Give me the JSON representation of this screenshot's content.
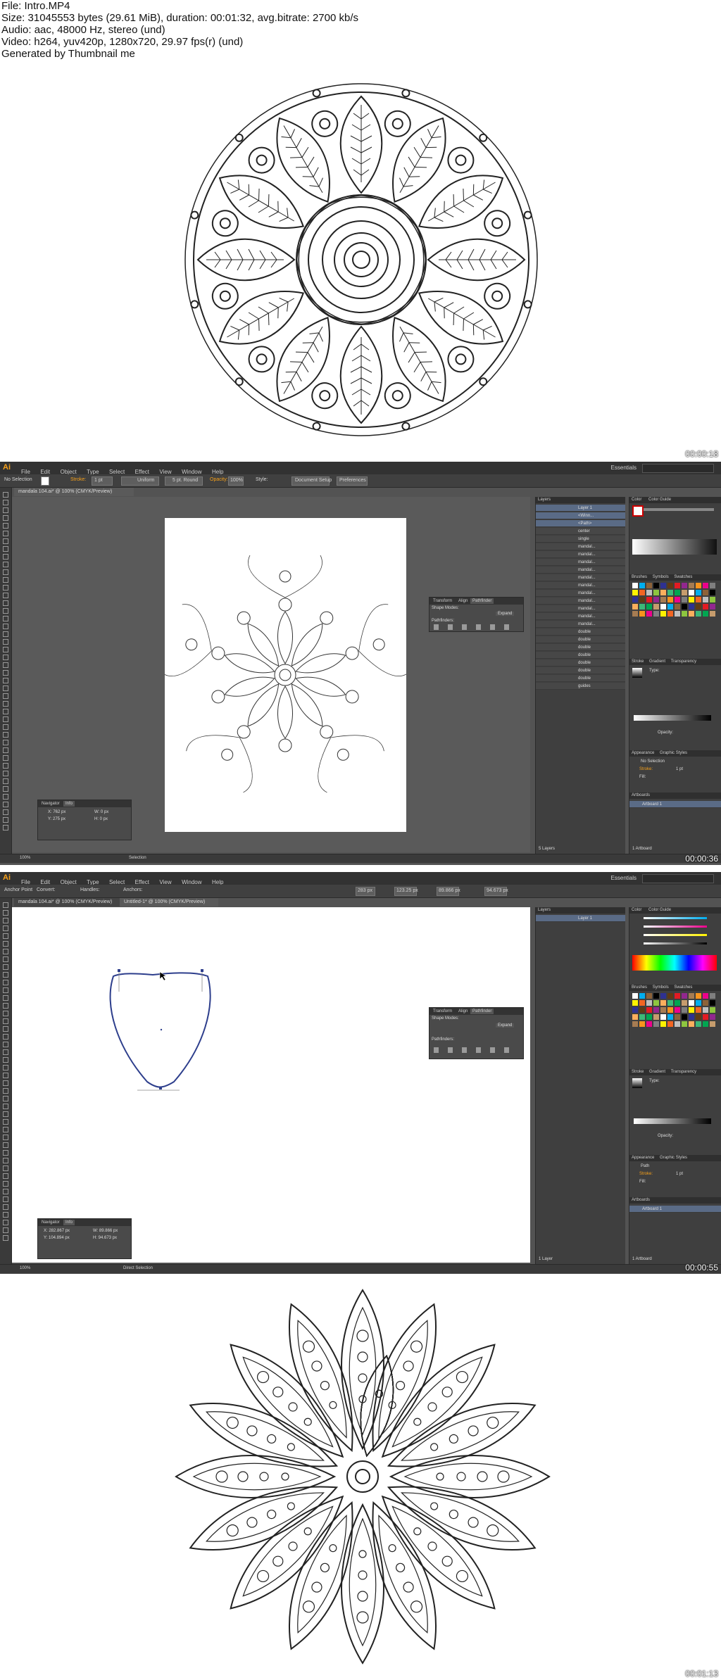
{
  "meta": {
    "file": "File: Intro.MP4",
    "size": "Size: 31045553 bytes (29.61 MiB), duration: 00:01:32, avg.bitrate: 2700 kb/s",
    "audio": "Audio: aac, 48000 Hz, stereo (und)",
    "video": "Video: h264, yuv420p, 1280x720, 29.97 fps(r) (und)",
    "generator": "Generated by Thumbnail me"
  },
  "frames": [
    {
      "timestamp": "00:00:18"
    },
    {
      "timestamp": "00:00:36"
    },
    {
      "timestamp": "00:00:55"
    },
    {
      "timestamp": "00:01:13"
    }
  ],
  "ai": {
    "logo": "Ai",
    "menus": [
      "File",
      "Edit",
      "Object",
      "Type",
      "Select",
      "Effect",
      "View",
      "Window",
      "Help"
    ],
    "workspace": "Essentials",
    "frame2": {
      "selection": "No Selection",
      "stroke_label": "Stroke:",
      "stroke_value": "1 pt",
      "uniform": "Uniform",
      "brush": "5 pt. Round",
      "opacity_label": "Opacity:",
      "opacity_value": "100%",
      "style_label": "Style:",
      "doc_setup": "Document Setup",
      "preferences": "Preferences",
      "tab": "mandala 104.ai* @ 100% (CMYK/Preview)",
      "zoom": "100%",
      "status_tool": "Selection",
      "layers_title": "Layers",
      "layers": [
        {
          "name": "Layer 1"
        },
        {
          "name": "<Winn..."
        },
        {
          "name": "<Path>"
        },
        {
          "name": "center"
        },
        {
          "name": "single"
        },
        {
          "name": "mandal..."
        },
        {
          "name": "mandal..."
        },
        {
          "name": "mandal..."
        },
        {
          "name": "mandal..."
        },
        {
          "name": "mandal..."
        },
        {
          "name": "mandal..."
        },
        {
          "name": "mandal..."
        },
        {
          "name": "mandal..."
        },
        {
          "name": "mandal..."
        },
        {
          "name": "mandal..."
        },
        {
          "name": "mandal..."
        },
        {
          "name": "double"
        },
        {
          "name": "double"
        },
        {
          "name": "double"
        },
        {
          "name": "double"
        },
        {
          "name": "double"
        },
        {
          "name": "double"
        },
        {
          "name": "double"
        },
        {
          "name": "guides"
        }
      ],
      "layers_count": "5 Layers",
      "pathfinder": {
        "tabs": [
          "Transform",
          "Align",
          "Pathfinder"
        ],
        "shape_modes": "Shape Modes:",
        "expand": "Expand",
        "pathfinders": "Pathfinders:"
      },
      "navigator": {
        "tabs": [
          "Navigator",
          "Info"
        ],
        "x": "X: 762 px",
        "y": "Y: 275 px",
        "w": "W: 0 px",
        "h": "H: 0 px"
      },
      "color_tabs": [
        "Color",
        "Color Guide"
      ],
      "brush_tabs": [
        "Brushes",
        "Symbols",
        "Swatches"
      ],
      "stroke_tabs": [
        "Stroke",
        "Gradient",
        "Transparency"
      ],
      "type_label": "Type:",
      "opacity2": "Opacity:",
      "appearance_tabs": [
        "Appearance",
        "Graphic Styles"
      ],
      "appearance_sel": "No Selection",
      "stroke_row": "Stroke:",
      "fill_row": "Fill:",
      "stroke_pt": "1 pt",
      "artboards_title": "Artboards",
      "artboard_1": "Artboard 1",
      "artboards_count": "1 Artboard"
    },
    "frame3": {
      "anchor": "Anchor Point",
      "convert": "Convert:",
      "handles": "Handles:",
      "anchors": "Anchors:",
      "x_val": "283 px",
      "y_val": "123.25 px",
      "w_val": "89.866 px",
      "h_val": "94.673 px",
      "tab1": "mandala 104.ai* @ 100% (CMYK/Preview)",
      "tab2": "Untitled-1* @ 100% (CMYK/Preview)",
      "layers": [
        {
          "name": "Layer 1"
        }
      ],
      "layers_count": "1 Layer",
      "status_tool": "Direct Selection",
      "zoom": "100%",
      "navigator": {
        "tabs": [
          "Navigator",
          "Info"
        ],
        "x": "X: 282.867 px",
        "y": "Y: 104.894 px",
        "w": "W: 89.866 px",
        "h": "H: 94.673 px"
      },
      "appearance_sel": "Path",
      "artboards_count": "1 Artboard"
    }
  },
  "colors": {
    "ai_orange": "#f7a11a",
    "ai_ui_dark": "#323232",
    "ai_canvas": "#5a5a5a",
    "path_blue": "#2d3e8c",
    "swatches": [
      "#ffffff",
      "#000000",
      "#e31b23",
      "#f7941d",
      "#fff200",
      "#8dc63f",
      "#00a651",
      "#00aeef",
      "#2e3192",
      "#92278f",
      "#ec008c",
      "#f26522",
      "#fbaf5d",
      "#c69c6d",
      "#8c6239",
      "#603913",
      "#a67c52",
      "#7f7f7f",
      "#bfbfbf",
      "#3cb878"
    ]
  }
}
